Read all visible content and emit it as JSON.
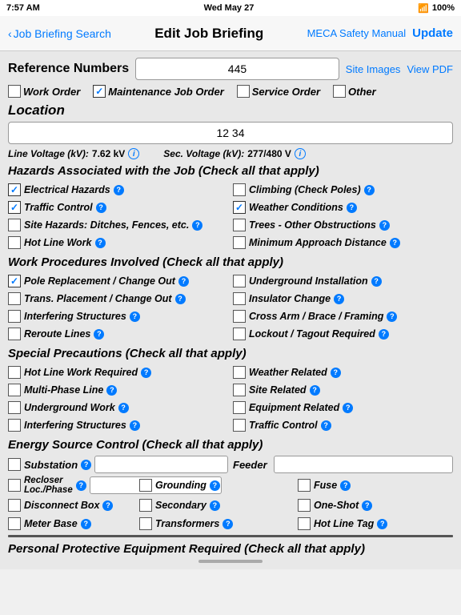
{
  "status_bar": {
    "time": "7:57 AM",
    "date": "Wed May 27",
    "wifi": "wifi-icon",
    "battery": "100%"
  },
  "nav": {
    "back_label": "Job Briefing Search",
    "title": "Edit Job Briefing",
    "safety_label": "MECA Safety Manual",
    "update_label": "Update"
  },
  "reference": {
    "label": "Reference Numbers",
    "value": "445",
    "site_images": "Site Images",
    "view_pdf": "View PDF"
  },
  "order_types": [
    {
      "id": "work_order",
      "label": "Work Order",
      "checked": false
    },
    {
      "id": "maint_job_order",
      "label": "Maintenance Job Order",
      "checked": true
    },
    {
      "id": "service_order",
      "label": "Service Order",
      "checked": false
    },
    {
      "id": "other",
      "label": "Other",
      "checked": false
    }
  ],
  "location": {
    "label": "Location",
    "value": "12 34"
  },
  "voltage": {
    "line_label": "Line Voltage (kV):",
    "line_value": "7.62 kV",
    "sec_label": "Sec. Voltage (kV):",
    "sec_value": "277/480 V"
  },
  "hazards": {
    "title": "Hazards Associated with the Job (Check all that apply)",
    "items": [
      {
        "label": "Electrical Hazards",
        "checked": true,
        "col": 0
      },
      {
        "label": "Climbing (Check Poles)",
        "checked": false,
        "col": 1
      },
      {
        "label": "Traffic Control",
        "checked": true,
        "col": 0
      },
      {
        "label": "Weather Conditions",
        "checked": true,
        "col": 1
      },
      {
        "label": "Site Hazards: Ditches, Fences, etc.",
        "checked": false,
        "col": 0
      },
      {
        "label": "Trees - Other Obstructions",
        "checked": false,
        "col": 1
      },
      {
        "label": "Hot Line Work",
        "checked": false,
        "col": 0
      },
      {
        "label": "Minimum Approach Distance",
        "checked": false,
        "col": 1
      }
    ]
  },
  "work_procedures": {
    "title": "Work Procedures Involved (Check all that apply)",
    "items": [
      {
        "label": "Pole Replacement / Change Out",
        "checked": true,
        "col": 0
      },
      {
        "label": "Underground Installation",
        "checked": false,
        "col": 1
      },
      {
        "label": "Trans. Placement / Change Out",
        "checked": false,
        "col": 0
      },
      {
        "label": "Insulator Change",
        "checked": false,
        "col": 1
      },
      {
        "label": "Interfering Structures",
        "checked": false,
        "col": 0
      },
      {
        "label": "Cross Arm / Brace / Framing",
        "checked": false,
        "col": 1
      },
      {
        "label": "Reroute Lines",
        "checked": false,
        "col": 0
      },
      {
        "label": "Lockout / Tagout Required",
        "checked": false,
        "col": 1
      }
    ]
  },
  "special_precautions": {
    "title": "Special Precautions (Check all that apply)",
    "items": [
      {
        "label": "Hot Line Work Required",
        "checked": false,
        "col": 0
      },
      {
        "label": "Weather Related",
        "checked": false,
        "col": 1
      },
      {
        "label": "Multi-Phase Line",
        "checked": false,
        "col": 0
      },
      {
        "label": "Site Related",
        "checked": false,
        "col": 1
      },
      {
        "label": "Underground Work",
        "checked": false,
        "col": 0
      },
      {
        "label": "Equipment Related",
        "checked": false,
        "col": 1
      },
      {
        "label": "Interfering Structures",
        "checked": false,
        "col": 0
      },
      {
        "label": "Traffic Control",
        "checked": false,
        "col": 1
      }
    ]
  },
  "energy_source": {
    "title": "Energy Source Control (Check all that apply)",
    "rows": [
      {
        "left": {
          "label": "Substation",
          "checked": false,
          "has_input": true,
          "input_value": ""
        },
        "right": {
          "label": "Feeder",
          "checked": false,
          "has_input": true,
          "input_value": ""
        }
      }
    ],
    "row2": [
      {
        "label": "Recloser Loc./Phase",
        "checked": false,
        "has_input": true,
        "input_value": ""
      },
      {
        "label": "Grounding",
        "checked": false,
        "has_input": false
      },
      {
        "label": "Fuse",
        "checked": false,
        "has_input": false
      }
    ],
    "row3": [
      {
        "label": "Disconnect Box",
        "checked": false,
        "has_input": false
      },
      {
        "label": "Secondary",
        "checked": false,
        "has_input": false
      },
      {
        "label": "One-Shot",
        "checked": false,
        "has_input": false
      }
    ],
    "row4": [
      {
        "label": "Meter Base",
        "checked": false,
        "has_input": false
      },
      {
        "label": "Transformers",
        "checked": false,
        "has_input": false
      },
      {
        "label": "Hot Line Tag",
        "checked": false,
        "has_input": false
      }
    ]
  },
  "ppe": {
    "title": "Personal Protective Equipment Required (Check all that apply)"
  }
}
